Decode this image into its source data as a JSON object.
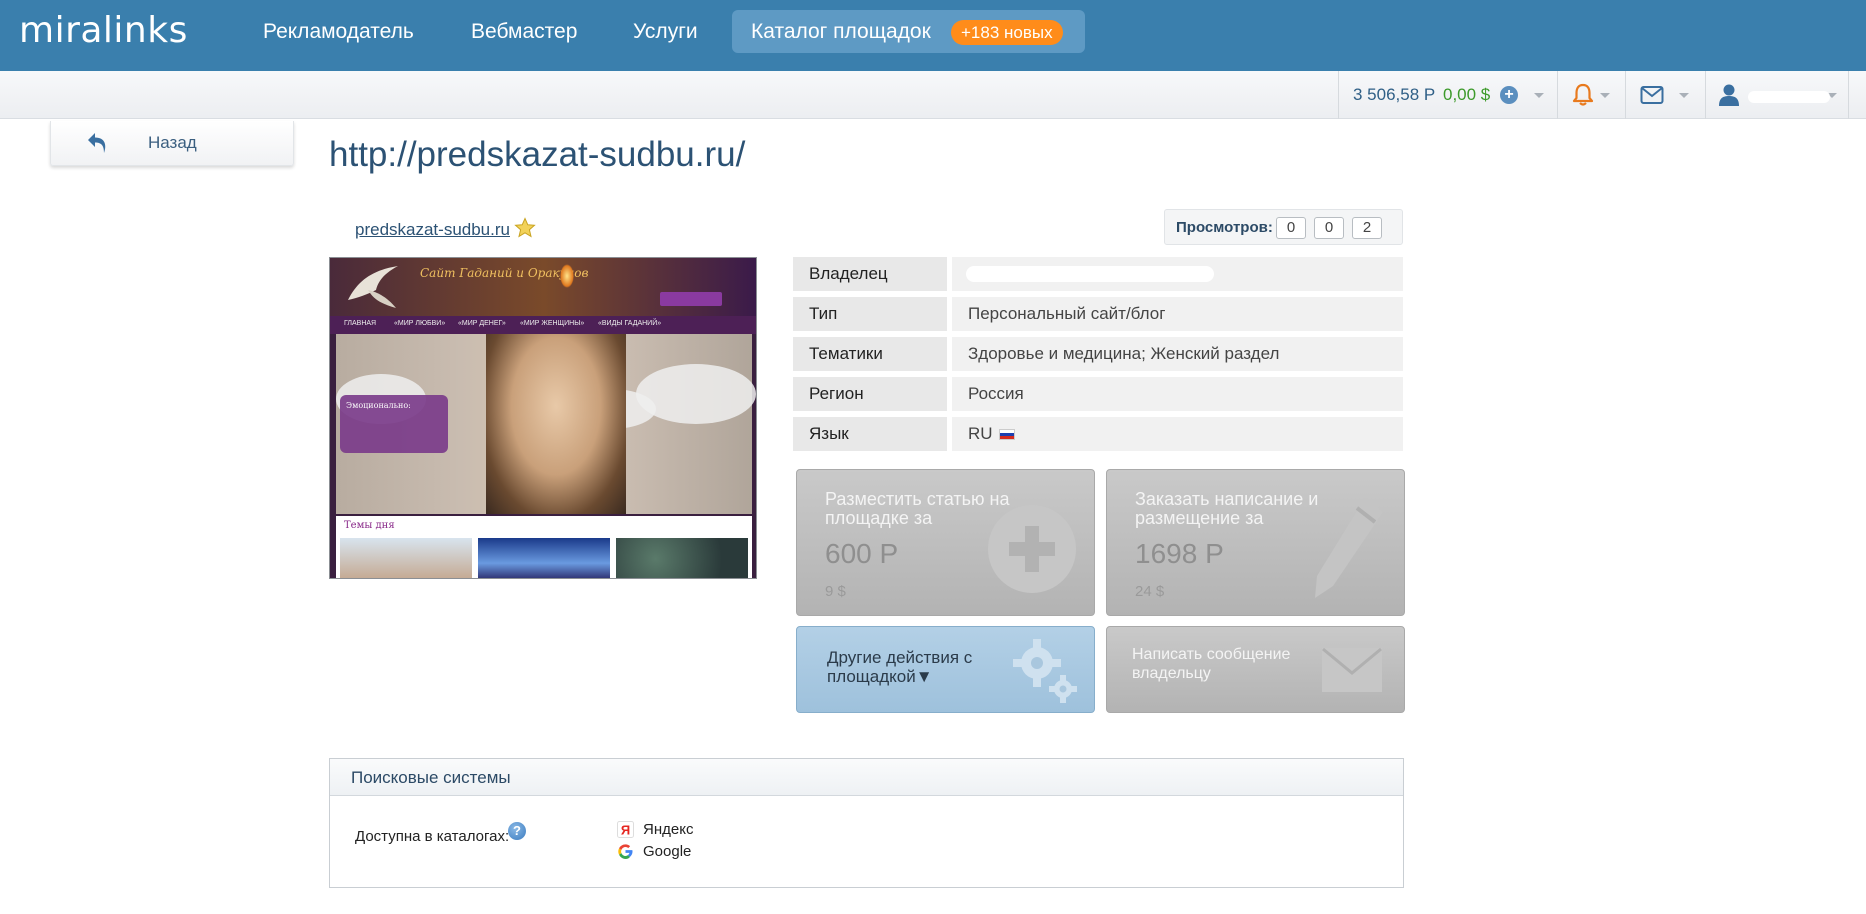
{
  "app": {
    "logo": "miralinks"
  },
  "nav": {
    "items": [
      {
        "label": "Рекламодатель"
      },
      {
        "label": "Вебмастер"
      },
      {
        "label": "Услуги"
      }
    ],
    "catalog": {
      "label": "Каталог площадок",
      "badge": "+183 новых"
    }
  },
  "account": {
    "balance_rub": "3 506,58 Р",
    "balance_usd": "0,00 $"
  },
  "back": {
    "label": "Назад"
  },
  "page": {
    "title": "http://predskazat-sudbu.ru/",
    "site_link": "predskazat-sudbu.ru"
  },
  "views": {
    "label": "Просмотров:",
    "counters": [
      "0",
      "0",
      "2"
    ]
  },
  "thumbnail": {
    "header_text": "Сайт Гаданий и Оракулов",
    "menu": [
      "ГЛАВНАЯ",
      "«МИР ЛЮБВИ»",
      "«МИР ДЕНЕГ»",
      "«МИР ЖЕНЩИНЫ»",
      "«ВИДЫ ГАДАНИЙ»"
    ],
    "caption": "Эмоционально:",
    "bottom_title": "Темы дня"
  },
  "info": {
    "rows": [
      {
        "key": "Владелец",
        "value": ""
      },
      {
        "key": "Тип",
        "value": "Персональный сайт/блог"
      },
      {
        "key": "Тематики",
        "value": "Здоровье и медицина; Женский раздел"
      },
      {
        "key": "Регион",
        "value": "Россия"
      },
      {
        "key": "Язык",
        "value": "RU"
      }
    ]
  },
  "actions": {
    "place_article": {
      "title": "Разместить статью на площадке за",
      "price": "600 Р",
      "sub": "9 $"
    },
    "order_writing": {
      "title": "Заказать написание и размещение за",
      "price": "1698 Р",
      "sub": "24 $"
    },
    "other_actions": {
      "title": "Другие действия с площадкой▼"
    },
    "message_owner": {
      "title": "Написать сообщение владельцу"
    }
  },
  "search_systems": {
    "title": "Поисковые системы",
    "catalogs_label": "Доступна в каталогах:",
    "engines": [
      "Яндекс",
      "Google"
    ]
  },
  "colors": {
    "topbar": "#3a7fad",
    "badge": "#ff8c1a",
    "title": "#2c5274"
  }
}
